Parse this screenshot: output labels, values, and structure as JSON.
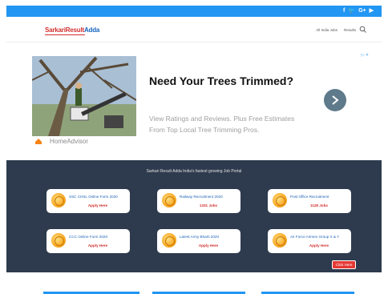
{
  "topbar": {
    "social": [
      "f",
      "🐦",
      "G+",
      "▶"
    ]
  },
  "header": {
    "logo_part1": "SarkariResult",
    "logo_part2": "Adda",
    "nav": [
      "All India Jobs",
      "Results"
    ]
  },
  "ad": {
    "close": "▷ ✕",
    "title": "Need Your Trees Trimmed?",
    "description": "View Ratings and Reviews. Plus Free Estimates From Top Local Tree Trimming Pros.",
    "brand": "HomeAdvisor"
  },
  "jobs": {
    "title": "Sarkari Result Adda India's fastest growing Job Portal",
    "cards": [
      {
        "title": "SSC CHSL Online Form 2020",
        "sub": "Apply Here"
      },
      {
        "title": "Railway Recruitment 2020",
        "sub": "1331 Jobs"
      },
      {
        "title": "Post Office Recruitment",
        "sub": "1128 Jobs"
      },
      {
        "title": "CCC Online Form 2020",
        "sub": "Apply Here"
      },
      {
        "title": "Latest Army Bharti 2020",
        "sub": "Apply Here"
      },
      {
        "title": "Air Force Airmen Group X & Y",
        "sub": "Apply Here"
      }
    ],
    "button": "Click Here"
  },
  "colors": {
    "accent": "#2196f3",
    "dark": "#2e3b4e",
    "red": "#d32f2f",
    "coin": "#f9a825"
  }
}
